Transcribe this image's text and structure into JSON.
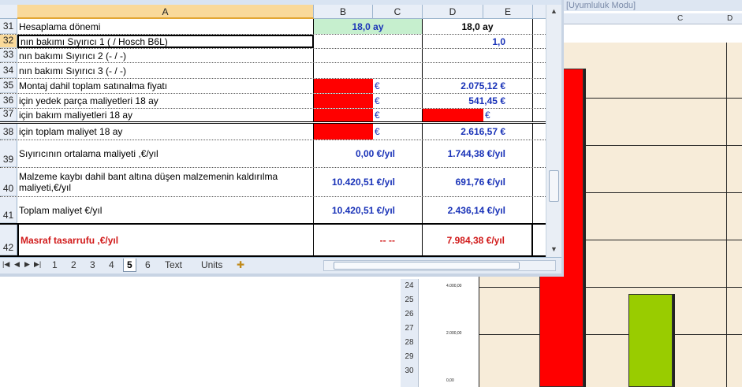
{
  "background_window": {
    "title": "[Uyumluluk Modu]",
    "columns": [
      "C",
      "D"
    ],
    "row_numbers": [
      "24",
      "25",
      "26",
      "27",
      "28",
      "29",
      "30"
    ],
    "y_ticks": [
      "4.000,00",
      "2.000,00",
      "0,00"
    ],
    "chart_colors": {
      "bar1": "#ff0000",
      "bar2": "#99cc00",
      "plot_bg": "#f7ecd9"
    }
  },
  "columns": [
    "A",
    "B",
    "C",
    "D",
    "E"
  ],
  "rows": [
    {
      "n": "31",
      "label": "Hesaplama dönemi",
      "b": "18,0 ay",
      "d": "18,0 ay"
    },
    {
      "n": "32",
      "label": "nın bakımı Sıyırıcı 1 (                           / Hosch B6L)",
      "b": "",
      "d": "1,0"
    },
    {
      "n": "33",
      "label": "nın bakımı Sıyırıcı 2 (- / -)",
      "b": "",
      "d": ""
    },
    {
      "n": "34",
      "label": "nın bakımı Sıyırıcı 3 (- / -)",
      "b": "",
      "d": ""
    },
    {
      "n": "35",
      "label": "Montaj dahil toplam satınalma fiyatı",
      "b_eur": "€",
      "d": "2.075,12 €"
    },
    {
      "n": "36",
      "label": "için yedek parça maliyetleri 18 ay",
      "b_eur": "€",
      "d": "541,45 €"
    },
    {
      "n": "37",
      "label": "için bakım maliyetleri 18 ay",
      "b_eur": "€",
      "d_eur": "€"
    },
    {
      "n": "38",
      "label": "için toplam maliyet 18 ay",
      "b_eur": "€",
      "d": "2.616,57 €"
    },
    {
      "n": "39",
      "label": "Sıyırıcının ortalama maliyeti ,€/yıl",
      "b": "0,00 €/yıl",
      "d": "1.744,38 €/yıl"
    },
    {
      "n": "40",
      "label": "Malzeme kaybı dahil bant altına düşen malzemenin kaldırılma maliyeti,€/yıl",
      "b": "10.420,51 €/yıl",
      "d": "691,76 €/yıl"
    },
    {
      "n": "41",
      "label": "Toplam maliyet €/yıl",
      "b": "10.420,51 €/yıl",
      "d": "2.436,14 €/yıl"
    },
    {
      "n": "42",
      "label": "Masraf tasarrufu ,€/yıl",
      "b": "-- --",
      "d": "7.984,38 €/yıl"
    }
  ],
  "sheet_tabs": [
    "1",
    "2",
    "3",
    "4",
    "5",
    "6",
    "Text",
    "Units"
  ],
  "active_tab": "5",
  "colors": {
    "red_fill": "#ff0000",
    "green_fill": "#c6efce",
    "value_blue": "#1a33b8",
    "savings_red": "#d11a1a"
  }
}
